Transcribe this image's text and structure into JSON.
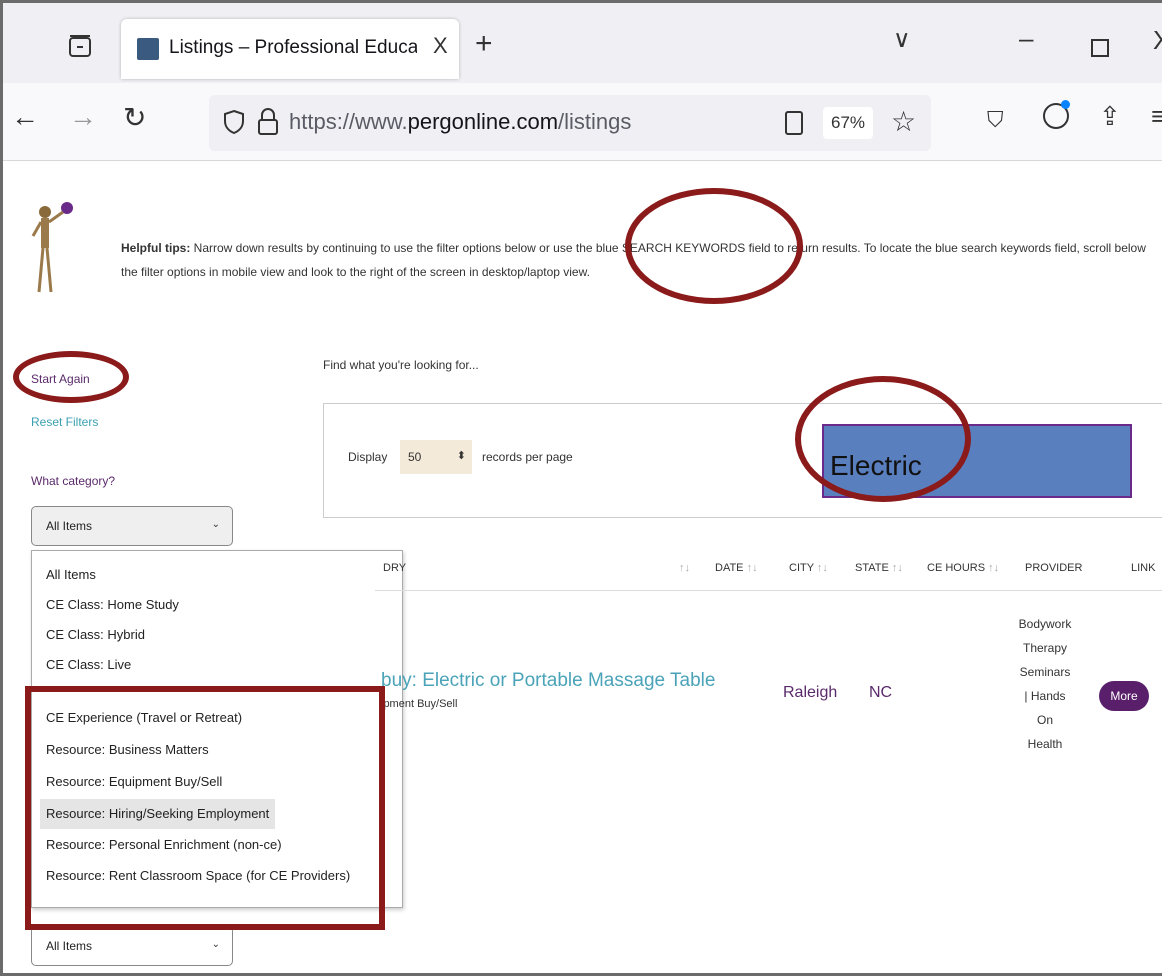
{
  "browser": {
    "tab_title": "Listings – Professional Education",
    "tab_close": "X",
    "new_tab": "+",
    "url_prefix": "https://www.",
    "url_domain": "pergonline.com",
    "url_path": "/listings",
    "zoom": "67%"
  },
  "tips": {
    "label": "Helpful tips:",
    "text": " Narrow down results by continuing to use the filter options below or use the blue SEARCH KEYWORDS field to return results. To locate the blue search keywords field, scroll below the filter options in mobile view and look to the right of the screen in desktop/laptop view."
  },
  "sidebar": {
    "start_again": "Start Again",
    "reset_filters": "Reset Filters",
    "category_label": "What category?",
    "category_selected": "All Items",
    "category_options": [
      "All Items",
      "CE Class: Home Study",
      "CE Class: Hybrid",
      "CE Class: Live",
      "CE Experience (Travel or Retreat)",
      "Resource: Business Matters",
      "Resource: Equipment Buy/Sell",
      "Resource: Hiring/Seeking Employment",
      "Resource: Personal Enrichment (non-ce)",
      "Resource: Rent Classroom Space (for CE Providers)"
    ],
    "second_select": "All Items"
  },
  "search": {
    "find_label": "Find what you're looking for...",
    "display_label": "Display",
    "display_value": "50",
    "records_label": "records per page",
    "keyword_value": "Electric"
  },
  "table": {
    "headers": [
      "DRY",
      "DATE",
      "CITY",
      "STATE",
      "CE HOURS",
      "PROVIDER",
      "LINK"
    ],
    "row": {
      "title": "buy: Electric or Portable Massage Table",
      "category": "ipment Buy/Sell",
      "city": "Raleigh",
      "state": "NC",
      "provider_lines": [
        "Bodywork",
        "Therapy",
        "Seminars",
        "| Hands",
        "On",
        "Health"
      ],
      "link_label": "More"
    }
  },
  "colors": {
    "annotation": "#8b1a1a",
    "keyword_bg": "#5a7fbf",
    "more_button": "#5a1f6a"
  }
}
